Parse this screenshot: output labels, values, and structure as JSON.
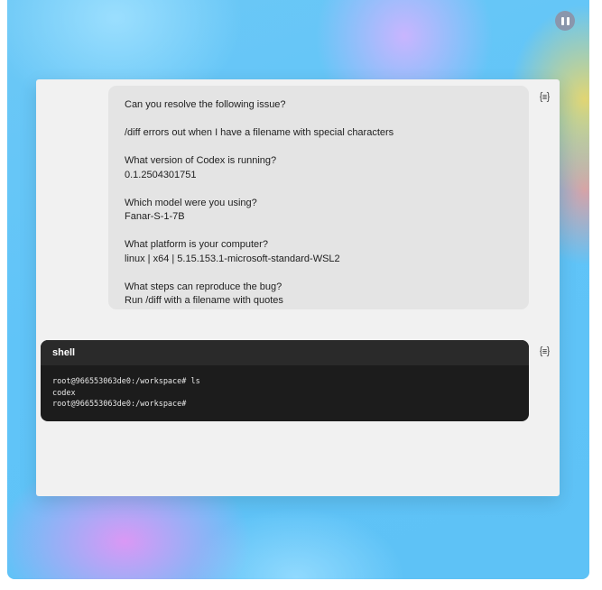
{
  "controls": {
    "pause_icon": "pause-icon"
  },
  "conversation": {
    "user_message": {
      "paragraphs": [
        "Can you resolve the following issue?",
        "/diff errors out when I have a filename with special characters",
        "What version of Codex is running?\n0.1.2504301751",
        "Which model were you using?\nFanar-S-1-7B",
        "What platform is your computer?\nlinux | x64 | 5.15.153.1-microsoft-standard-WSL2",
        "What steps can reproduce the bug?\nRun /diff with a filename with quotes"
      ],
      "icon": "message-json-icon"
    },
    "shell": {
      "title": "shell",
      "lines": [
        "root@966553063de0:/workspace# ls",
        "codex",
        "root@966553063de0:/workspace#"
      ],
      "icon": "message-json-icon"
    }
  },
  "colors": {
    "panel_bg": "#f1f1f1",
    "user_bubble_bg": "#e4e4e4",
    "shell_bg": "#1c1c1c",
    "shell_header_bg": "#2a2a2a",
    "pause_button_bg": "#8a96ac"
  }
}
